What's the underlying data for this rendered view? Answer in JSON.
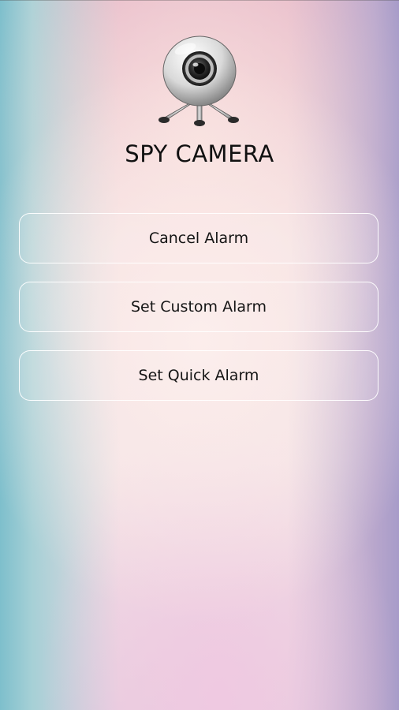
{
  "app": {
    "title": "SPY CAMERA",
    "logo_icon": "webcam-icon"
  },
  "menu": {
    "items": [
      {
        "id": "cancel_alarm",
        "label": "Cancel Alarm"
      },
      {
        "id": "set_custom_alarm",
        "label": "Set Custom Alarm"
      },
      {
        "id": "set_quick_alarm",
        "label": "Set Quick Alarm"
      }
    ]
  },
  "colors": {
    "text": "#111111",
    "button_border": "#ffffff",
    "background_left": "#7ebfcc",
    "background_right": "#a79cc9",
    "background_center": "#f8e6e4"
  }
}
